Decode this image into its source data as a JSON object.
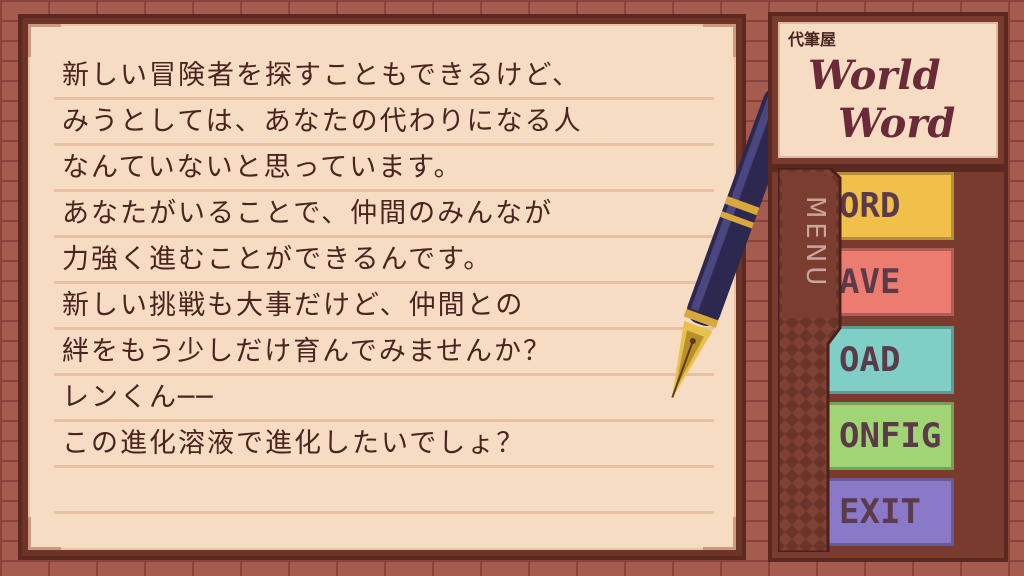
{
  "letter": {
    "lines": [
      "新しい冒険者を探すこともできるけど、",
      "みうとしては、あなたの代わりになる人",
      "なんていないと思っています。",
      "あなたがいることで、仲間のみんなが",
      "力強く進むことができるんです。",
      "新しい挑戦も大事だけど、仲間との",
      "絆をもう少しだけ育んでみませんか？",
      "レンくん──",
      "この進化溶液で進化したいでしょ？",
      ""
    ]
  },
  "sign": {
    "shop_name": "代筆屋",
    "title_line1": "World",
    "title_line2": "Word"
  },
  "menu": {
    "label": "MENU",
    "items": [
      {
        "label": "RECORD",
        "visible": "ORD"
      },
      {
        "label": "SAVE",
        "visible": "AVE"
      },
      {
        "label": "LOAD",
        "visible": "OAD"
      },
      {
        "label": "CONFIG",
        "visible": "ONFIG"
      },
      {
        "label": "EXIT",
        "visible": "EXIT"
      }
    ]
  },
  "colors": {
    "paper": "#f6dcc3",
    "frame": "#6d3427",
    "text": "#4a2520",
    "record_tab": "#f0c048",
    "save_tab": "#ec7b70",
    "load_tab": "#7fcfc7",
    "config_tab": "#a0d474",
    "exit_tab": "#8a78c8"
  }
}
